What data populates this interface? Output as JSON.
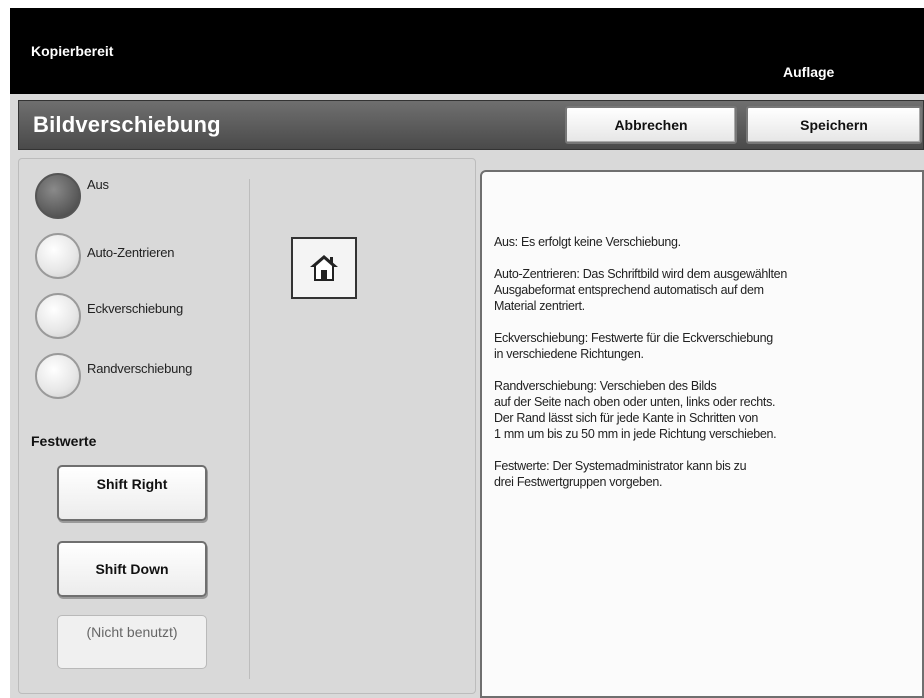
{
  "status": {
    "text": "Kopierbereit",
    "quantity_label": "Auflage"
  },
  "header": {
    "title": "Bildverschiebung",
    "cancel_label": "Abbrechen",
    "save_label": "Speichern"
  },
  "options": [
    {
      "label": "Aus",
      "selected": true
    },
    {
      "label": "Auto-Zentrieren",
      "selected": false
    },
    {
      "label": "Eckverschiebung",
      "selected": false
    },
    {
      "label": "Randverschiebung",
      "selected": false
    }
  ],
  "presets": {
    "label": "Festwerte",
    "items": [
      "Shift Right",
      "Shift Down",
      "(Nicht benutzt)"
    ]
  },
  "icons": {
    "home": "home-icon"
  },
  "info": {
    "paragraphs": [
      "Aus: Es erfolgt keine Verschiebung.",
      "Auto-Zentrieren: Das Schriftbild wird dem ausgewählten\nAusgabeformat entsprechend automatisch auf dem\nMaterial zentriert.",
      "Eckverschiebung: Festwerte für die Eckverschiebung\nin verschiedene Richtungen.",
      "Randverschiebung: Verschieben des Bilds\nauf der Seite nach oben oder unten, links oder rechts.\nDer Rand lässt sich für jede Kante in Schritten von\n1 mm um bis zu 50 mm in jede Richtung verschieben.",
      "Festwerte: Der Systemadministrator kann bis zu\ndrei Festwertgruppen vorgeben."
    ]
  }
}
